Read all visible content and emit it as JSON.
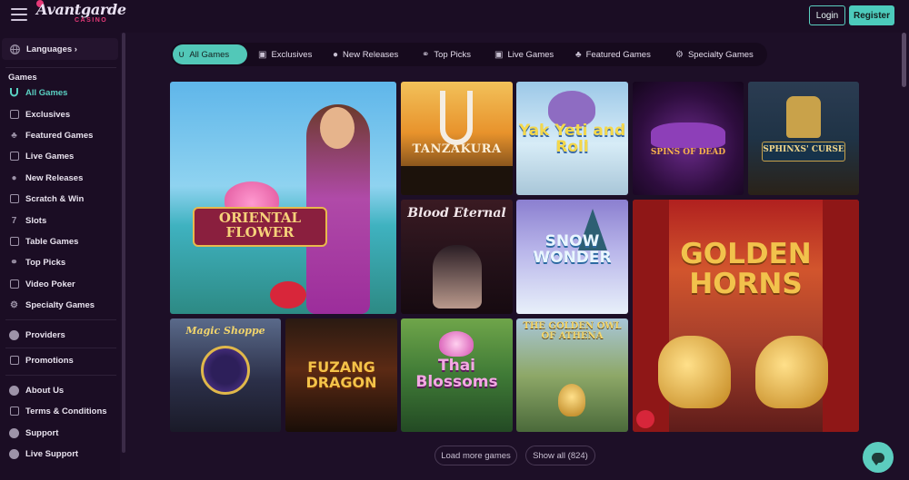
{
  "header": {
    "logo_text": "Avantgarde",
    "logo_sub": "CASINO",
    "login_label": "Login",
    "register_label": "Register"
  },
  "sidebar": {
    "languages_label": "Languages ›",
    "games_heading": "Games",
    "game_items": [
      {
        "label": "All Games",
        "icon": "horseshoe-icon"
      },
      {
        "label": "Exclusives",
        "icon": "exclusive-icon"
      },
      {
        "label": "Featured Games",
        "icon": "clover-icon"
      },
      {
        "label": "Live Games",
        "icon": "live-icon"
      },
      {
        "label": "New Releases",
        "icon": "new-releases-icon"
      },
      {
        "label": "Scratch & Win",
        "icon": "scratch-icon"
      },
      {
        "label": "Slots",
        "icon": "seven-icon"
      },
      {
        "label": "Table Games",
        "icon": "table-icon"
      },
      {
        "label": "Top Picks",
        "icon": "medal-icon"
      },
      {
        "label": "Video Poker",
        "icon": "video-poker-icon"
      },
      {
        "label": "Specialty Games",
        "icon": "gear-icon"
      }
    ],
    "providers_label": "Providers",
    "promotions_label": "Promotions",
    "info_items": [
      {
        "label": "About Us",
        "icon": "info-icon"
      },
      {
        "label": "Terms & Conditions",
        "icon": "document-icon"
      },
      {
        "label": "Support",
        "icon": "support-icon"
      },
      {
        "label": "Live Support",
        "icon": "chat-icon"
      }
    ]
  },
  "tabs": [
    {
      "label": "All Games",
      "icon": "horseshoe-icon",
      "active": true
    },
    {
      "label": "Exclusives",
      "icon": "exclusive-icon"
    },
    {
      "label": "New Releases",
      "icon": "new-releases-icon"
    },
    {
      "label": "Top Picks",
      "icon": "medal-icon"
    },
    {
      "label": "Live Games",
      "icon": "live-icon"
    },
    {
      "label": "Featured Games",
      "icon": "clover-icon"
    },
    {
      "label": "Specialty Games",
      "icon": "gear-icon"
    }
  ],
  "games": {
    "oriental_flower": "ORIENTAL FLOWER",
    "tanzakura": "TANZAKURA",
    "yak_yeti_roll": "Yak Yeti and Roll",
    "spins_of_dead": "SPINS OF DEAD",
    "sphinxs_curse": "SPHINXS' CURSE",
    "blood_eternal": "Blood Eternal",
    "snow_wonder": "SNOW WONDER",
    "golden_horns": "GOLDEN HORNS",
    "magic_shoppe": "Magic Shoppe",
    "fuzang_dragon": "FUZANG DRAGON",
    "thai_blossoms": "Thai Blossoms",
    "golden_owl_athena": "THE GOLDEN OWL OF ATHENA"
  },
  "footer": {
    "load_more_label": "Load more games",
    "show_all_label": "Show all (824)"
  },
  "colors": {
    "accent": "#52c8b8",
    "background": "#1d0f27",
    "sidebar": "#1b0d24"
  }
}
